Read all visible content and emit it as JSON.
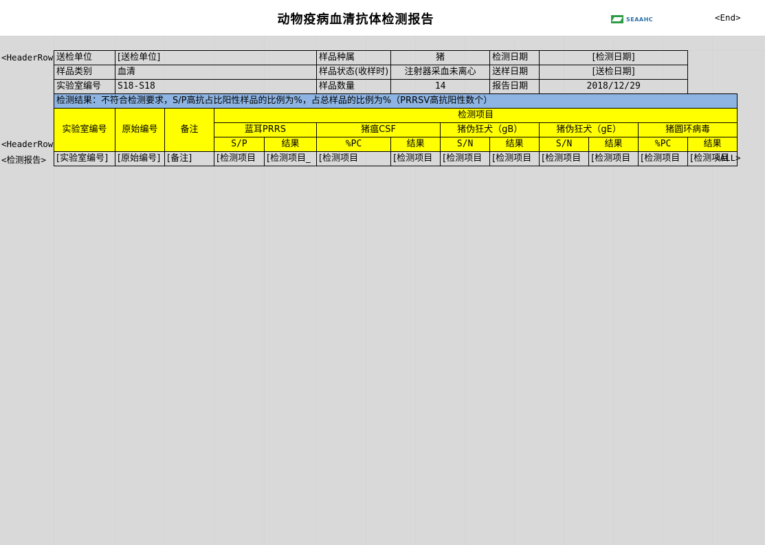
{
  "title": "动物疫病血清抗体检测报告",
  "logo_text": "SEAAHC",
  "markers": {
    "end": "<End>",
    "header_row_1": "<HeaderRow",
    "header_row_2": "<HeaderRow",
    "report": "<检测报告>",
    "all": "<ALL>"
  },
  "info": {
    "row1": [
      "送检单位",
      "[送检单位]",
      "样品种属",
      "猪",
      "检测日期",
      "[检测日期]"
    ],
    "row2": [
      "样品类别",
      "血清",
      "样品状态(收样时)",
      "注射器采血未离心",
      "送样日期",
      "[送检日期]"
    ],
    "row3": [
      "实验室编号",
      "S18-S18",
      "样品数量",
      "14",
      "报告日期",
      "2018/12/29"
    ]
  },
  "result_text": "检测结果：不符合检测要求，S/P高抗占比阳性样品的比例为%，占总样品的比例为%（PRRSV高抗阳性数个）",
  "headers": {
    "lab_no": "实验室编号",
    "orig_no": "原始编号",
    "remark": "备注",
    "items": "检测项目",
    "groups": [
      "蓝耳PRRS",
      "猪瘟CSF",
      "猪伪狂犬（gB）",
      "猪伪狂犬（gE）",
      "猪圆环病毒"
    ],
    "subs": [
      "S/P",
      "结果",
      "%PC",
      "结果",
      "S/N",
      "结果",
      "S/N",
      "结果",
      "%PC",
      "结果"
    ]
  },
  "data_row": [
    "[实验室编号]",
    "[原始编号]",
    "[备注]",
    "[检测项目",
    "[检测项目_",
    "[检测项目",
    "[检测项目",
    "[检测项目",
    "[检测项目",
    "[检测项目",
    "[检测项目",
    "[检测项目",
    "[检测项目"
  ]
}
